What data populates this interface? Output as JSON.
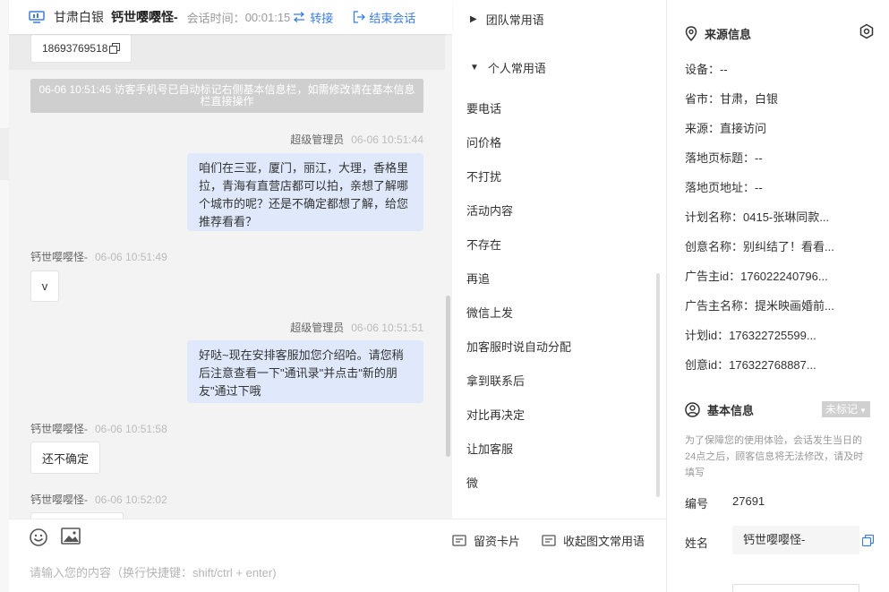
{
  "header": {
    "location": "甘肃白银",
    "visitor_name": "钙世嘤嘤怪-",
    "time_label": "会话时间：",
    "time_value": "00:01:15",
    "transfer_label": "转接",
    "end_label": "结束会话"
  },
  "chat": {
    "phone": "18693769518",
    "system_note": "06-06 10:51:45 访客手机号已自动标记右侧基本信息栏，如需修改请在基本信息栏直接操作",
    "messages": [
      {
        "who": "超级管理员",
        "ts": "06-06 10:51:44",
        "text": "咱们在三亚，厦门，丽江，大理，香格里拉，青海有直营店都可以拍，亲想了解哪个城市的呢？还是不确定都想了解，给您推荐看看？"
      },
      {
        "who": "钙世嘤嘤怪-",
        "ts": "06-06 10:51:49",
        "text": "v"
      },
      {
        "who": "超级管理员",
        "ts": "06-06 10:51:51",
        "text": "好哒~现在安排客服加您介绍哈。请您稍后注意查看一下\"通讯录\"并点击\"新的朋友\"通过下哦"
      },
      {
        "who": "钙世嘤嘤怪-",
        "ts": "06-06 10:51:58",
        "text": "还不确定"
      },
      {
        "who": "钙世嘤嘤怪-",
        "ts": "06-06 10:52:02",
        "text": ""
      }
    ],
    "input_placeholder": "请输入您的内容（换行快捷键：shift/ctrl + enter)"
  },
  "phrases": {
    "team_group": "团队常用语",
    "personal_group": "个人常用语",
    "items": [
      "要电话",
      "问价格",
      "不打扰",
      "活动内容",
      "不存在",
      "再追",
      "微信上发",
      "加客服时说自动分配",
      "拿到联系后",
      "对比再决定",
      "让加客服",
      "微"
    ],
    "card_button": "留资卡片",
    "fold_button": "收起图文常用语"
  },
  "info": {
    "source_title": "来源信息",
    "source_rows": [
      "设备：--",
      "省市：甘肃，白银",
      "来源：直接访问",
      "落地页标题：--",
      "落地页地址：--",
      "计划名称：0415-张琳同款...",
      "创意名称：别纠结了！看看...",
      "广告主id：176022240796...",
      "广告主名称：提米映画婚前...",
      "计划id：176322725599...",
      "创意id：176322768887..."
    ],
    "basic_title": "基本信息",
    "badge": "未标记",
    "note": "为了保障您的使用体验，会话发生当日的24点之后，顾客信息将无法修改，请及时填写",
    "number_label": "编号",
    "number_value": "27691",
    "name_label": "姓名",
    "name_value": "钙世嘤嘤怪-"
  },
  "colors": {
    "accent": "#3b7ddd",
    "agent_bubble": "#dfe9fb",
    "system_note": "#cfcfcf"
  }
}
